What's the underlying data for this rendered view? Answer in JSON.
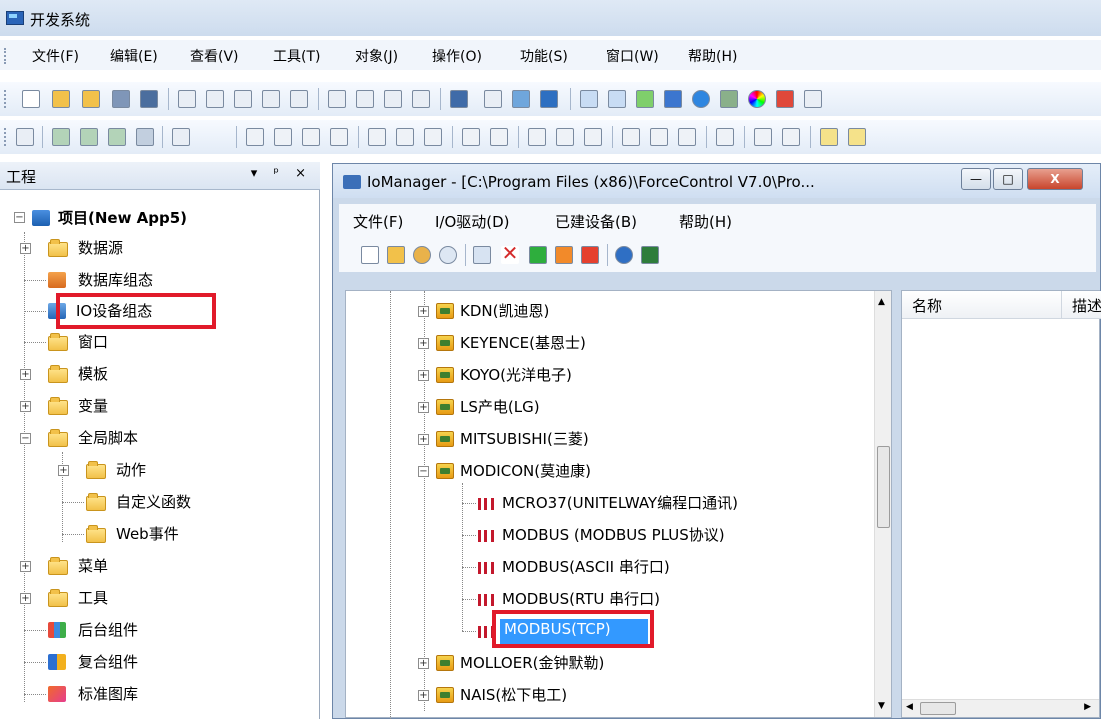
{
  "app": {
    "title": "开发系统"
  },
  "menubar": {
    "items": [
      "文件(F)",
      "编辑(E)",
      "查看(V)",
      "工具(T)",
      "对象(J)",
      "操作(O)",
      "功能(S)",
      "窗口(W)",
      "帮助(H)"
    ]
  },
  "left_pane": {
    "title": "工程",
    "controls": "▾ ᵖ ×",
    "tree": [
      {
        "label": "项目(New App5)",
        "icon": "project-icon",
        "bold": true
      },
      {
        "label": "数据源",
        "icon": "folder-icon"
      },
      {
        "label": "数据库组态",
        "icon": "database-config-icon"
      },
      {
        "label": "IO设备组态",
        "icon": "io-device-icon",
        "highlighted": true
      },
      {
        "label": "窗口",
        "icon": "folder-icon"
      },
      {
        "label": "模板",
        "icon": "folder-icon"
      },
      {
        "label": "变量",
        "icon": "folder-icon"
      },
      {
        "label": "全局脚本",
        "icon": "folder-icon"
      },
      {
        "label": "动作",
        "icon": "folder-icon"
      },
      {
        "label": "自定义函数",
        "icon": "folder-icon"
      },
      {
        "label": "Web事件",
        "icon": "folder-icon"
      },
      {
        "label": "菜单",
        "icon": "folder-icon"
      },
      {
        "label": "工具",
        "icon": "folder-icon"
      },
      {
        "label": "后台组件",
        "icon": "background-component-icon"
      },
      {
        "label": "复合组件",
        "icon": "composite-component-icon"
      },
      {
        "label": "标准图库",
        "icon": "standard-gallery-icon"
      }
    ]
  },
  "iomanager": {
    "title": "IoManager - [C:\\Program Files (x86)\\ForceControl V7.0\\Pro...",
    "menu": [
      "文件(F)",
      "I/O驱动(D)",
      "已建设备(B)",
      "帮助(H)"
    ],
    "devices": [
      {
        "label": "KDN(凯迪恩)"
      },
      {
        "label": "KEYENCE(基恩士)"
      },
      {
        "label": "KOYO(光洋电子)"
      },
      {
        "label": "LS产电(LG)"
      },
      {
        "label": "MITSUBISHI(三菱)"
      },
      {
        "label": "MODICON(莫迪康)"
      }
    ],
    "drivers": [
      {
        "label": "MCRO37(UNITELWAY编程口通讯)"
      },
      {
        "label": "MODBUS (MODBUS PLUS协议)"
      },
      {
        "label": "MODBUS(ASCII 串行口)"
      },
      {
        "label": "MODBUS(RTU 串行口)"
      },
      {
        "label": "MODBUS(TCP)",
        "selected": true
      }
    ],
    "devices_after": [
      {
        "label": "MOLLOER(金钟默勒)"
      },
      {
        "label": "NAIS(松下电工)"
      }
    ],
    "columns": [
      "名称",
      "描述"
    ]
  },
  "colors": {
    "highlight_box": "#e11a2a",
    "selection": "#3399ff"
  }
}
